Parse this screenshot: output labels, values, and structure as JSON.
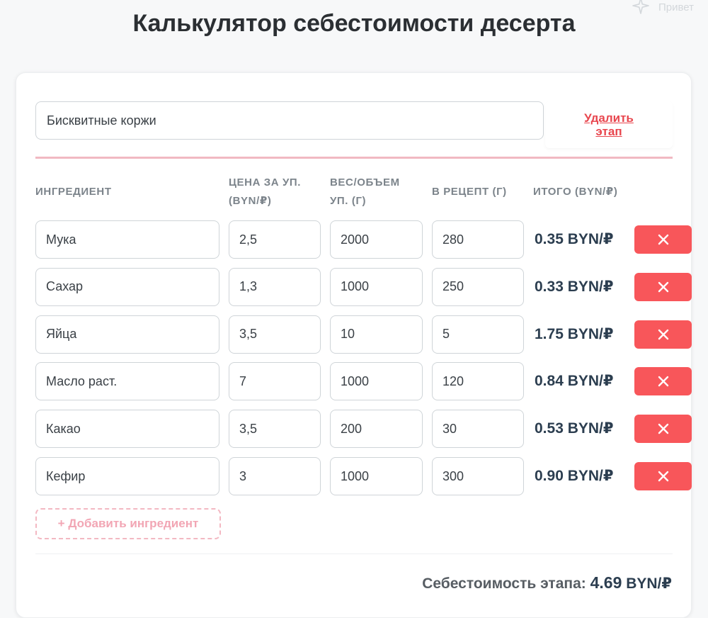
{
  "page_title": "Калькулятор себестоимости десерта",
  "corner_label": "Привет",
  "stage": {
    "name": "Бисквитные коржи",
    "delete_label": "Удалить этап"
  },
  "columns": {
    "ingredient": "ИНГРЕДИЕНТ",
    "price": "ЦЕНА ЗА УП. (BYN/₽)",
    "weight": "ВЕС/ОБЪЕМ УП. (Г)",
    "recipe": "В РЕЦЕПТ (Г)",
    "total": "ИТОГО (BYN/₽)"
  },
  "rows": [
    {
      "name": "Мука",
      "price": "2,5",
      "weight": "2000",
      "recipe": "280",
      "total": "0.35 BYN/₽"
    },
    {
      "name": "Сахар",
      "price": "1,3",
      "weight": "1000",
      "recipe": "250",
      "total": "0.33 BYN/₽"
    },
    {
      "name": "Яйца",
      "price": "3,5",
      "weight": "10",
      "recipe": "5",
      "total": "1.75 BYN/₽"
    },
    {
      "name": "Масло раст.",
      "price": "7",
      "weight": "1000",
      "recipe": "120",
      "total": "0.84 BYN/₽"
    },
    {
      "name": "Какао",
      "price": "3,5",
      "weight": "200",
      "recipe": "30",
      "total": "0.53 BYN/₽"
    },
    {
      "name": "Кефир",
      "price": "3",
      "weight": "1000",
      "recipe": "300",
      "total": "0.90 BYN/₽"
    }
  ],
  "add_ingredient_label": "+ Добавить ингредиент",
  "stage_total": {
    "label": "Себестоимость этапа:",
    "amount": "4.69",
    "currency": "BYN/₽"
  },
  "icons": {
    "corner": "sparkle-icon",
    "delete_row": "close-icon"
  },
  "colors": {
    "accent": "#e8464e",
    "delete_button": "#f8565a",
    "divider": "#f1b9c2",
    "add_button": "#f2a6b4"
  }
}
